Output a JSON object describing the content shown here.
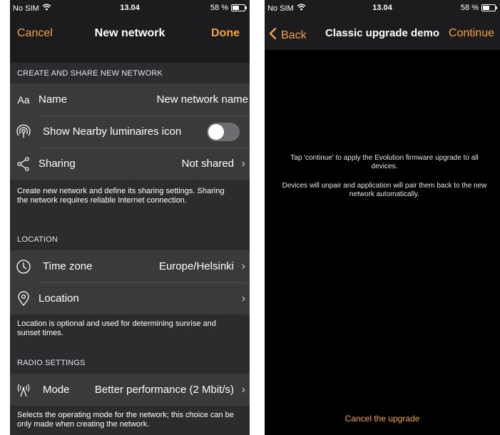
{
  "screen1": {
    "status": {
      "carrier": "No SIM",
      "time": "13.04",
      "battery": "58 %",
      "battery_fraction": 0.58
    },
    "nav": {
      "cancel": "Cancel",
      "title": "New network",
      "done": "Done"
    },
    "create_section": {
      "header": "CREATE AND SHARE NEW NETWORK",
      "name_icon": "Aa",
      "name_label": "Name",
      "name_value": "New network name",
      "nearby_label": "Show Nearby luminaires icon",
      "nearby_enabled": false,
      "sharing_label": "Sharing",
      "sharing_value": "Not shared",
      "footer": "Create new network and define its sharing settings. Sharing the network requires reliable Internet connection."
    },
    "location_section": {
      "header": "LOCATION",
      "timezone_label": "Time zone",
      "timezone_value": "Europe/Helsinki",
      "location_label": "Location",
      "footer": "Location is optional and used for determining sunrise and sunset times."
    },
    "radio_section": {
      "header": "RADIO SETTINGS",
      "mode_label": "Mode",
      "mode_value": "Better performance (2 Mbit/s)",
      "footer": "Selects the operating mode for the network; this choice can be only made when creating the network."
    },
    "icons": [
      "text-size-icon",
      "nearby-icon",
      "share-icon",
      "clock-icon",
      "location-pin-icon",
      "antenna-icon",
      "chevron-right-icon",
      "wifi-icon",
      "battery-icon"
    ]
  },
  "screen2": {
    "status": {
      "carrier": "No SIM",
      "time": "13.04",
      "battery": "58 %",
      "battery_fraction": 0.58
    },
    "nav": {
      "back": "Back",
      "title": "Classic upgrade demo",
      "continue": "Continue"
    },
    "info1": "Tap 'continue' to apply the Evolution firmware upgrade to all devices.",
    "info2": "Devices will unpair and application will pair them back to the new network automatically.",
    "cancel": "Cancel the upgrade"
  },
  "colors": {
    "accent": "#f2a33a",
    "background": "#2c2c2e",
    "cell": "#3a3a3c"
  }
}
